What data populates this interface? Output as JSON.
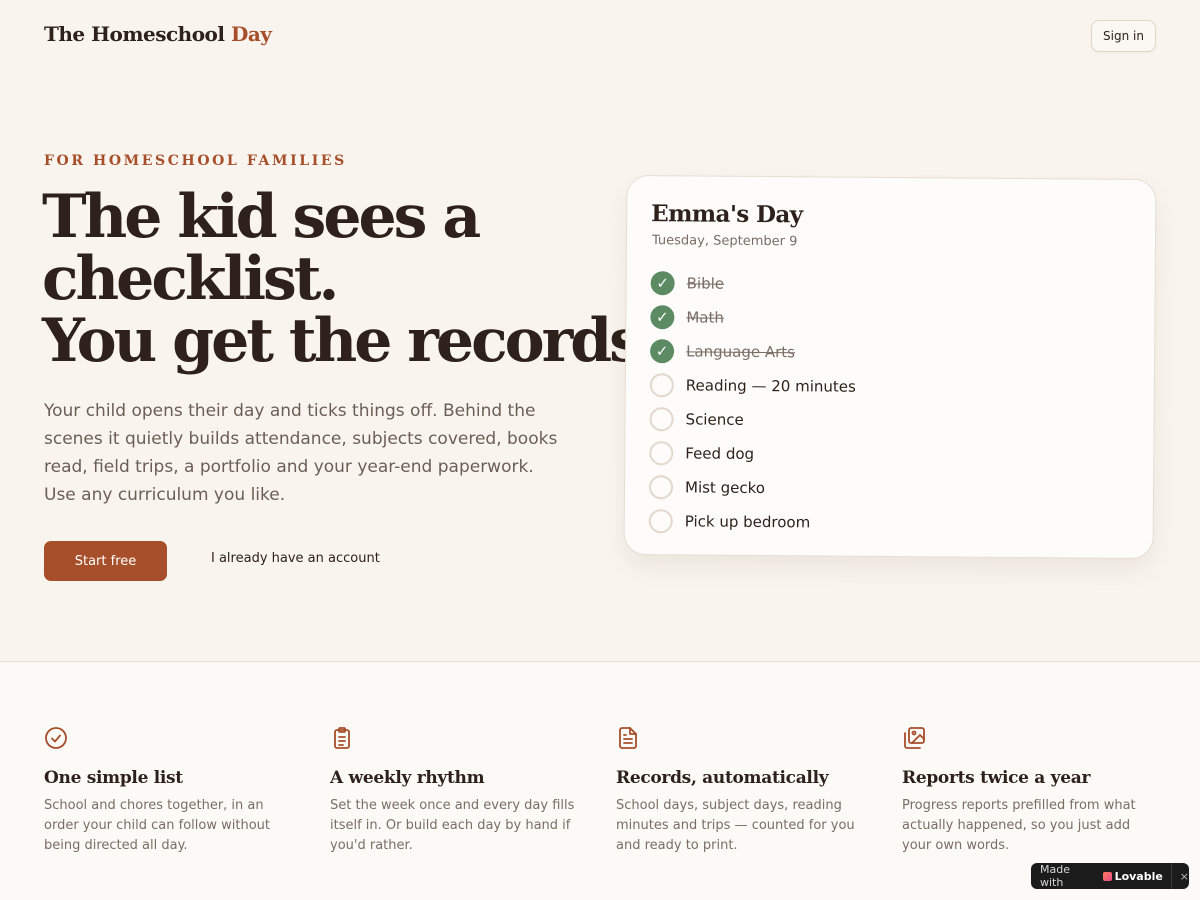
{
  "header": {
    "logo_main": "The Homeschool",
    "logo_accent": "Day",
    "signin_label": "Sign in"
  },
  "hero": {
    "eyebrow": "FOR HOMESCHOOL FAMILIES",
    "headline_lines": [
      "The kid sees a",
      "checklist.",
      "You get the records."
    ],
    "lede": "Your child opens their day and ticks things off. Behind the scenes it quietly builds attendance, subjects covered, books read, field trips, a portfolio and your year-end paperwork. Use any curriculum you like.",
    "primary_cta": "Start free",
    "secondary_cta": "I already have an account"
  },
  "card": {
    "title": "Emma's Day",
    "date": "Tuesday, September 9",
    "tasks": [
      {
        "label": "Bible",
        "done": true
      },
      {
        "label": "Math",
        "done": true
      },
      {
        "label": "Language Arts",
        "done": true
      },
      {
        "label": "Reading — 20 minutes",
        "done": false
      },
      {
        "label": "Science",
        "done": false
      },
      {
        "label": "Feed dog",
        "done": false
      },
      {
        "label": "Mist gecko",
        "done": false
      },
      {
        "label": "Pick up bedroom",
        "done": false
      }
    ]
  },
  "features": [
    {
      "icon": "check-circle-icon",
      "title": "One simple list",
      "body": "School and chores together, in an order your child can follow without being directed all day."
    },
    {
      "icon": "clipboard-list-icon",
      "title": "A weekly rhythm",
      "body": "Set the week once and every day fills itself in. Or build each day by hand if you'd rather."
    },
    {
      "icon": "document-icon",
      "title": "Records, automatically",
      "body": "School days, subject days, reading minutes and trips — counted for you and ready to print."
    },
    {
      "icon": "images-icon",
      "title": "Reports twice a year",
      "body": "Progress reports prefilled from what actually happened, so you just add your own words."
    }
  ],
  "badge": {
    "text": "Made with",
    "brand": "Lovable",
    "close": "×"
  },
  "colors": {
    "background": "#f9f5ee",
    "accent": "#a74e2a",
    "ink": "#2e211b",
    "check_green": "#5c8a63"
  }
}
